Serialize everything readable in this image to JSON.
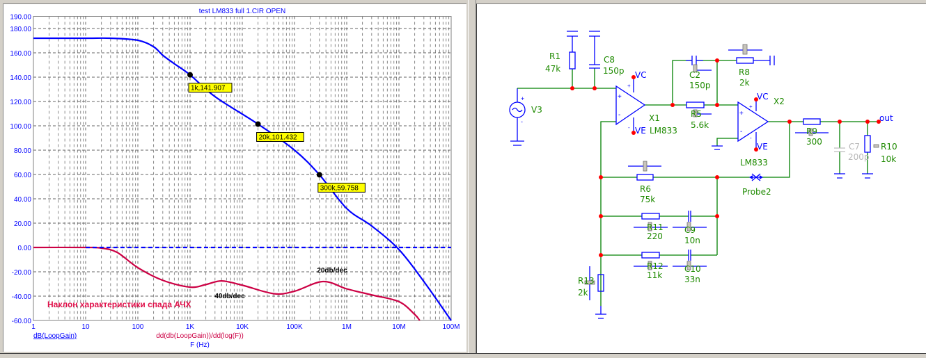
{
  "plot": {
    "title": "test LM833 full 1.CIR OPEN",
    "legend_left": "dB(LoopGain)",
    "legend_right": "dd(db(LoopGain))/dd(log(F))",
    "xaxis_label": "F (Hz)",
    "annotations": {
      "slope20": "20db/dec",
      "slope40": "40db/dec",
      "caption": "Наклон характеристики спада АЧХ"
    }
  },
  "chart_data": {
    "type": "line",
    "title": "test LM833 full 1.CIR OPEN",
    "xlabel": "F (Hz)",
    "xscale": "log",
    "xlim": [
      1,
      100000000
    ],
    "ylim": [
      -60,
      190
    ],
    "grid": true,
    "x_ticks": [
      "1",
      "10",
      "100",
      "1K",
      "10K",
      "100K",
      "1M",
      "10M",
      "100M"
    ],
    "y_ticks": [
      "190.00",
      "180.00",
      "160.00",
      "140.00",
      "120.00",
      "100.00",
      "80.00",
      "60.00",
      "40.00",
      "20.00",
      "0.00",
      "-20.00",
      "-40.00",
      "-60.00"
    ],
    "series": [
      {
        "name": "dB(LoopGain)",
        "color": "#0000ff",
        "x": [
          1,
          10,
          30,
          100,
          200,
          300,
          500,
          1000,
          3000,
          20000,
          100000,
          300000,
          1000000,
          3000000,
          10000000,
          30000000,
          100000000
        ],
        "y": [
          172,
          172,
          172,
          170.3,
          165,
          158,
          151,
          141.9,
          124,
          101.4,
          80,
          59.76,
          32,
          17.7,
          -1.7,
          -28,
          -60
        ]
      },
      {
        "name": "dd(db(LoopGain))/dd(log(F))",
        "color": "#cc0044",
        "x": [
          1,
          10,
          20,
          40,
          100,
          300,
          1000,
          2000,
          4000,
          10000,
          40000,
          100000,
          350000,
          1000000,
          3000000,
          10000000,
          20000000,
          25000000
        ],
        "y": [
          0,
          0,
          -0.5,
          -4,
          -16.6,
          -27,
          -32.6,
          -30.5,
          -27.5,
          -31,
          -38,
          -36,
          -28,
          -34,
          -39,
          -44.5,
          -55,
          -60
        ]
      },
      {
        "name": "0 dB reference",
        "color": "#0000ff",
        "dashed": true,
        "x": [
          10,
          100000000
        ],
        "y": [
          0,
          0
        ]
      }
    ],
    "markers": [
      {
        "x": 1000,
        "y": 141.907,
        "label": "1k,141.907"
      },
      {
        "x": 20000,
        "y": 101.432,
        "label": "20k,101.432"
      },
      {
        "x": 300000,
        "y": 59.758,
        "label": "300k,59.758"
      }
    ],
    "colors": {
      "axis_text": "#0000ff",
      "marker_label_bg": "#ffff00"
    }
  },
  "schematic": {
    "V3": "V3",
    "R1": {
      "name": "R1",
      "value": "47k"
    },
    "C8": {
      "name": "C8",
      "value": "150p"
    },
    "X1": {
      "name": "X1",
      "model": "LM833",
      "vc": "VC",
      "ve": "VE"
    },
    "C2": {
      "name": "C2",
      "value": "150p"
    },
    "R8": {
      "name": "R8",
      "value": "2k"
    },
    "R5": {
      "name": "R5",
      "value": "5.6k"
    },
    "X2": {
      "name": "X2",
      "model": "LM833",
      "vc": "VC",
      "ve": "VE"
    },
    "R9": {
      "name": "R9",
      "value": "300"
    },
    "C7": {
      "name": "C7",
      "value": "200p"
    },
    "R10": {
      "name": "R10",
      "value": "10k"
    },
    "out": "out",
    "R6": {
      "name": "R6",
      "value": "75k"
    },
    "Probe": "Probe2",
    "R11": {
      "name": "R11",
      "value": "220"
    },
    "C9": {
      "name": "C9",
      "value": "10n"
    },
    "R12": {
      "name": "R12",
      "value": "11k"
    },
    "C10": {
      "name": "C10",
      "value": "33n"
    },
    "R13": {
      "name": "R13",
      "value": "2k"
    }
  }
}
